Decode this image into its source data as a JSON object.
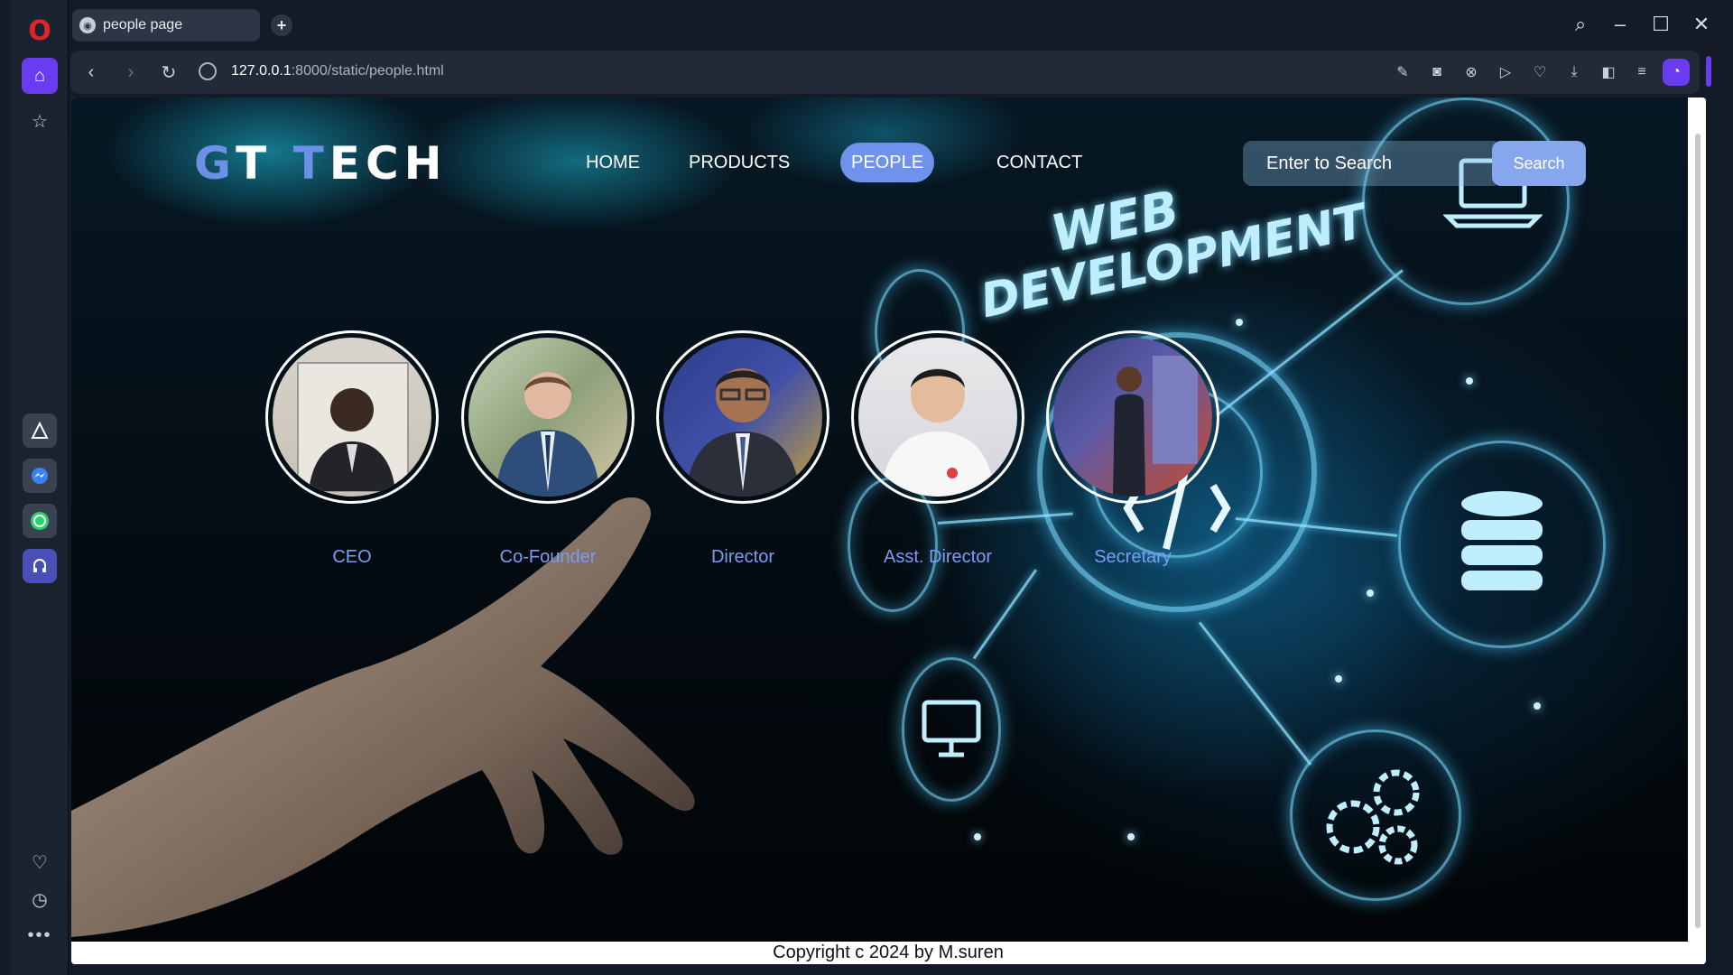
{
  "browser": {
    "tab_title": "people page",
    "url_host": "127.0.0.1",
    "url_path": ":8000/static/people.html",
    "new_tab": "+"
  },
  "site": {
    "logo_part1": "G",
    "logo_part2": "T ",
    "logo_part3": "T",
    "logo_part4": "ECH",
    "nav": [
      "HOME",
      "PRODUCTS",
      "PEOPLE",
      "CONTACT"
    ],
    "active_nav": "PEOPLE",
    "search_placeholder": "Enter to Search",
    "search_button": "Search",
    "banner_line1": "WEB",
    "banner_line2": "DEVELOPMENT"
  },
  "people": [
    {
      "role": "CEO"
    },
    {
      "role": "Co-Founder"
    },
    {
      "role": "Director"
    },
    {
      "role": "Asst. Director"
    },
    {
      "role": "Secretary"
    }
  ],
  "footer": "Copyright c 2024 by M.suren",
  "colors": {
    "accent": "#6f92ec",
    "role_text": "#7b9cf2",
    "opera_red": "#e0242c",
    "sidebar_active": "#6a3cf0"
  }
}
